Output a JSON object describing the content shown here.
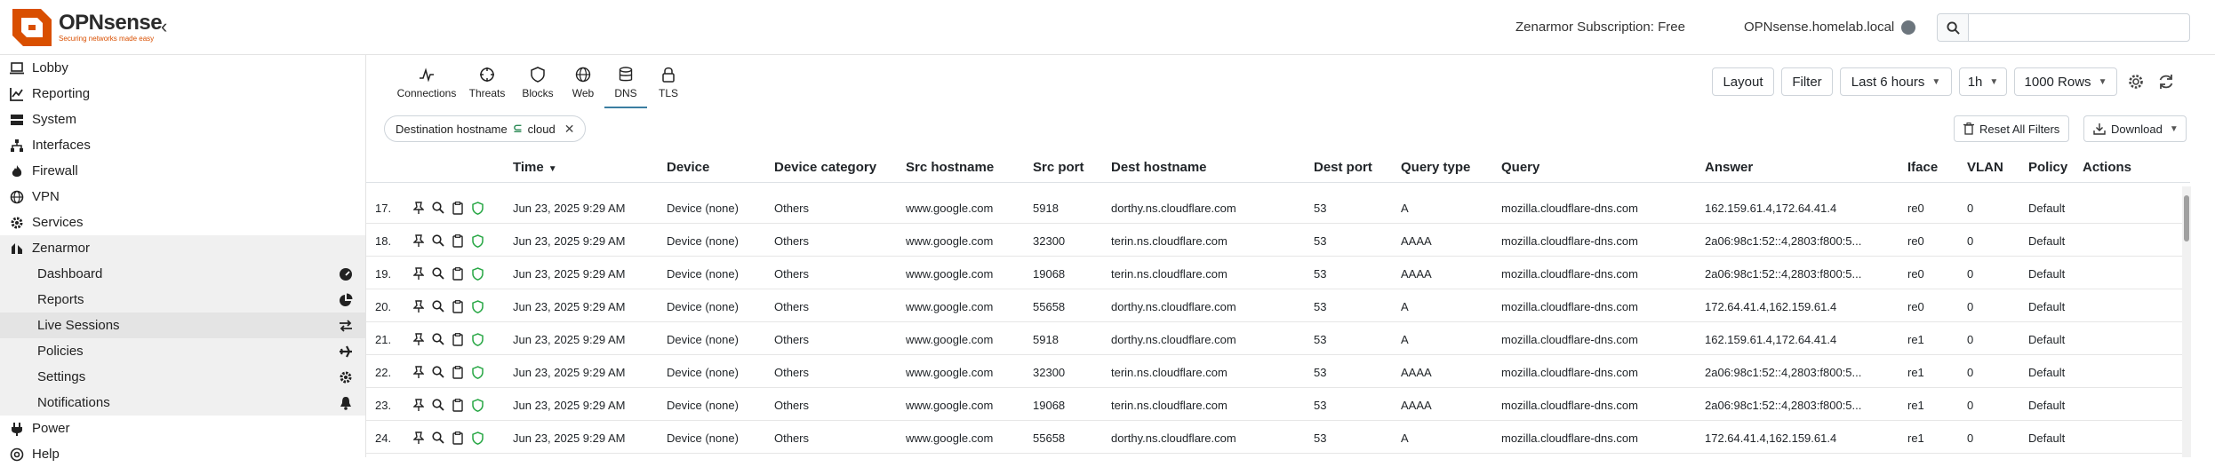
{
  "header": {
    "brand": "OPNsense",
    "tagline": "Securing networks made easy",
    "subscription": "Zenarmor Subscription: Free",
    "hostname": "OPNsense.homelab.local",
    "search_placeholder": "",
    "brand_color": "#d94f00"
  },
  "sidebar": {
    "items": [
      {
        "label": "Lobby",
        "icon": "laptop-icon"
      },
      {
        "label": "Reporting",
        "icon": "chart-icon"
      },
      {
        "label": "System",
        "icon": "server-icon"
      },
      {
        "label": "Interfaces",
        "icon": "sitemap-icon"
      },
      {
        "label": "Firewall",
        "icon": "fire-icon"
      },
      {
        "label": "VPN",
        "icon": "globe-icon"
      },
      {
        "label": "Services",
        "icon": "gear-icon"
      },
      {
        "label": "Zenarmor",
        "icon": "zenarmor-icon"
      }
    ],
    "zenarmor_sub": [
      {
        "label": "Dashboard",
        "icon": "gauge-icon"
      },
      {
        "label": "Reports",
        "icon": "pie-icon"
      },
      {
        "label": "Live Sessions",
        "icon": "arrows-icon"
      },
      {
        "label": "Policies",
        "icon": "plane-icon"
      },
      {
        "label": "Settings",
        "icon": "gear-icon"
      },
      {
        "label": "Notifications",
        "icon": "bell-icon"
      }
    ],
    "bottom": [
      {
        "label": "Power",
        "icon": "plug-icon"
      },
      {
        "label": "Help",
        "icon": "help-icon"
      }
    ]
  },
  "tabs": [
    {
      "label": "Connections",
      "icon": "pulse-icon"
    },
    {
      "label": "Threats",
      "icon": "crosshair-icon"
    },
    {
      "label": "Blocks",
      "icon": "shield-icon"
    },
    {
      "label": "Web",
      "icon": "globe-icon"
    },
    {
      "label": "DNS",
      "icon": "database-icon"
    },
    {
      "label": "TLS",
      "icon": "lock-icon"
    }
  ],
  "controls": {
    "layout": "Layout",
    "filter": "Filter",
    "range": "Last 6 hours",
    "interval": "1h",
    "rows": "1000 Rows"
  },
  "filter_chip": {
    "field": "Destination hostname",
    "op": "⊆",
    "value": "cloud"
  },
  "buttons": {
    "reset": "Reset All Filters",
    "download": "Download"
  },
  "columns": [
    "Time",
    "Device",
    "Device category",
    "Src hostname",
    "Src port",
    "Dest hostname",
    "Dest port",
    "Query type",
    "Query",
    "Answer",
    "Iface",
    "VLAN",
    "Policy",
    "Actions"
  ],
  "rows": [
    {
      "n": "17.",
      "time": "Jun 23, 2025 9:29 AM",
      "device": "Device (none)",
      "category": "Others",
      "src": "www.google.com",
      "sport": "5918",
      "dest": "dorthy.ns.cloudflare.com",
      "dport": "53",
      "qtype": "A",
      "query": "mozilla.cloudflare-dns.com",
      "answer": "162.159.61.4,172.64.41.4",
      "iface": "re0",
      "vlan": "0",
      "policy": "Default"
    },
    {
      "n": "18.",
      "time": "Jun 23, 2025 9:29 AM",
      "device": "Device (none)",
      "category": "Others",
      "src": "www.google.com",
      "sport": "32300",
      "dest": "terin.ns.cloudflare.com",
      "dport": "53",
      "qtype": "AAAA",
      "query": "mozilla.cloudflare-dns.com",
      "answer": "2a06:98c1:52::4,2803:f800:5...",
      "iface": "re0",
      "vlan": "0",
      "policy": "Default"
    },
    {
      "n": "19.",
      "time": "Jun 23, 2025 9:29 AM",
      "device": "Device (none)",
      "category": "Others",
      "src": "www.google.com",
      "sport": "19068",
      "dest": "terin.ns.cloudflare.com",
      "dport": "53",
      "qtype": "AAAA",
      "query": "mozilla.cloudflare-dns.com",
      "answer": "2a06:98c1:52::4,2803:f800:5...",
      "iface": "re0",
      "vlan": "0",
      "policy": "Default"
    },
    {
      "n": "20.",
      "time": "Jun 23, 2025 9:29 AM",
      "device": "Device (none)",
      "category": "Others",
      "src": "www.google.com",
      "sport": "55658",
      "dest": "dorthy.ns.cloudflare.com",
      "dport": "53",
      "qtype": "A",
      "query": "mozilla.cloudflare-dns.com",
      "answer": "172.64.41.4,162.159.61.4",
      "iface": "re0",
      "vlan": "0",
      "policy": "Default"
    },
    {
      "n": "21.",
      "time": "Jun 23, 2025 9:29 AM",
      "device": "Device (none)",
      "category": "Others",
      "src": "www.google.com",
      "sport": "5918",
      "dest": "dorthy.ns.cloudflare.com",
      "dport": "53",
      "qtype": "A",
      "query": "mozilla.cloudflare-dns.com",
      "answer": "162.159.61.4,172.64.41.4",
      "iface": "re1",
      "vlan": "0",
      "policy": "Default"
    },
    {
      "n": "22.",
      "time": "Jun 23, 2025 9:29 AM",
      "device": "Device (none)",
      "category": "Others",
      "src": "www.google.com",
      "sport": "32300",
      "dest": "terin.ns.cloudflare.com",
      "dport": "53",
      "qtype": "AAAA",
      "query": "mozilla.cloudflare-dns.com",
      "answer": "2a06:98c1:52::4,2803:f800:5...",
      "iface": "re1",
      "vlan": "0",
      "policy": "Default"
    },
    {
      "n": "23.",
      "time": "Jun 23, 2025 9:29 AM",
      "device": "Device (none)",
      "category": "Others",
      "src": "www.google.com",
      "sport": "19068",
      "dest": "terin.ns.cloudflare.com",
      "dport": "53",
      "qtype": "AAAA",
      "query": "mozilla.cloudflare-dns.com",
      "answer": "2a06:98c1:52::4,2803:f800:5...",
      "iface": "re1",
      "vlan": "0",
      "policy": "Default"
    },
    {
      "n": "24.",
      "time": "Jun 23, 2025 9:29 AM",
      "device": "Device (none)",
      "category": "Others",
      "src": "www.google.com",
      "sport": "55658",
      "dest": "dorthy.ns.cloudflare.com",
      "dport": "53",
      "qtype": "A",
      "query": "mozilla.cloudflare-dns.com",
      "answer": "172.64.41.4,162.159.61.4",
      "iface": "re1",
      "vlan": "0",
      "policy": "Default"
    }
  ]
}
